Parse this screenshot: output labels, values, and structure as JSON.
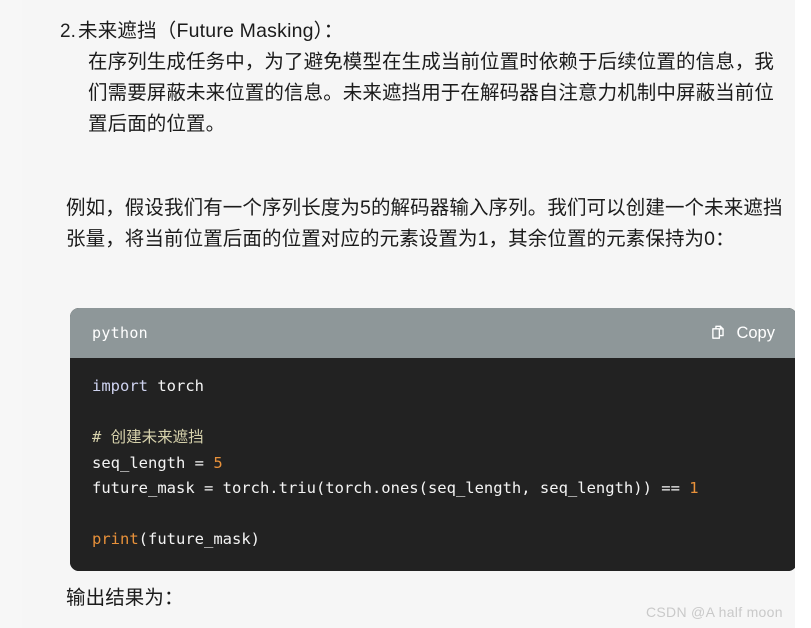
{
  "article": {
    "list_item": {
      "marker": "2.",
      "title": "未来遮挡（Future Masking）：",
      "paragraph": "在序列生成任务中，为了避免模型在生成当前位置时依赖于后续位置的信息，我们需要屏蔽未来位置的信息。未来遮挡用于在解码器自注意力机制中屏蔽当前位置后面的位置。"
    },
    "example_paragraph": "例如，假设我们有一个序列长度为5的解码器输入序列。我们可以创建一个未来遮挡张量，将当前位置后面的位置对应的元素设置为1，其余位置的元素保持为0：",
    "output_paragraph": "输出结果为："
  },
  "code_block": {
    "language": "python",
    "copy_label": "Copy",
    "copy_icon": "copy-icon",
    "header_bg": "#8e9799",
    "body_bg": "#222222",
    "lines": [
      {
        "tokens": [
          {
            "text": "import",
            "type": "kw"
          },
          {
            "text": " torch",
            "type": "plain"
          }
        ]
      },
      {
        "tokens": []
      },
      {
        "tokens": [
          {
            "text": "# 创建未来遮挡",
            "type": "comment"
          }
        ]
      },
      {
        "tokens": [
          {
            "text": "seq_length = ",
            "type": "plain"
          },
          {
            "text": "5",
            "type": "num"
          }
        ]
      },
      {
        "tokens": [
          {
            "text": "future_mask = torch.triu(torch.ones(seq_length, seq_length)) == ",
            "type": "plain"
          },
          {
            "text": "1",
            "type": "num"
          }
        ]
      },
      {
        "tokens": []
      },
      {
        "tokens": [
          {
            "text": "print",
            "type": "fn"
          },
          {
            "text": "(future_mask)",
            "type": "plain"
          }
        ]
      }
    ]
  },
  "watermark": {
    "text": "CSDN @A half moon"
  },
  "colors": {
    "page_bg": "#f6f6f6",
    "text": "#1b1b1b",
    "keyword": "#cfd3f0",
    "comment": "#d7d2ac",
    "number": "#e8913a",
    "function": "#e8913a",
    "watermark": "#c9c9c9"
  }
}
